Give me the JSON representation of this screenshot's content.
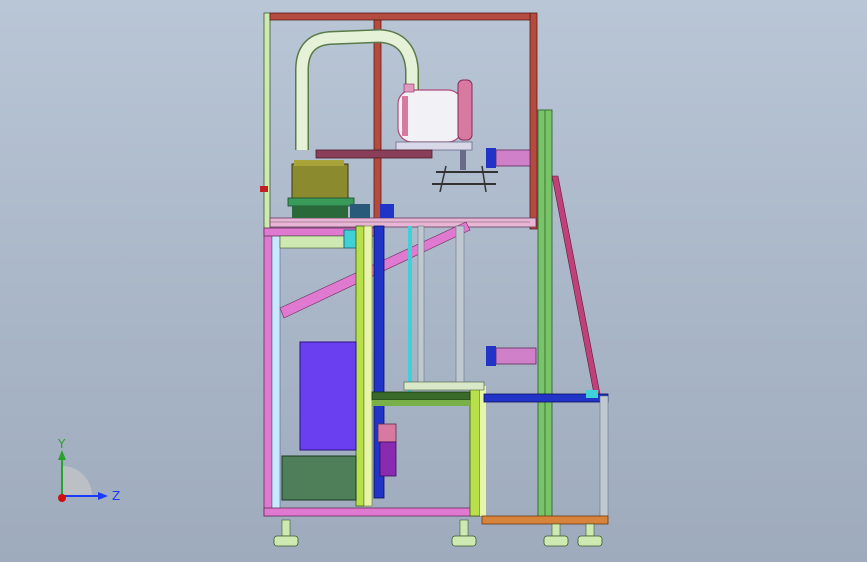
{
  "viewport": {
    "background_top": "#b9c6d6",
    "background_bottom": "#9eabbd"
  },
  "colors": {
    "frame_pink": "#e07ad0",
    "frame_red": "#b54a3e",
    "frame_lightgreen": "#cfe9b2",
    "frame_yellowgreen": "#b8e04a",
    "frame_green": "#79c36a",
    "frame_blue": "#2233c8",
    "frame_cyan": "#3fd0d8",
    "frame_orange": "#d8833c",
    "purple_panel": "#6a3ff0",
    "dark_green_panel": "#4f7f58",
    "robot_body": "#f2f2f6",
    "robot_accent": "#d87aa0",
    "olive_box": "#8c8a2f",
    "tube": "#e6f2d8"
  },
  "triad": {
    "y_label": "Y",
    "z_label": "Z",
    "y_icon": "y-axis-arrow-icon",
    "z_icon": "z-axis-arrow-icon",
    "origin_icon": "origin-dot-icon"
  }
}
